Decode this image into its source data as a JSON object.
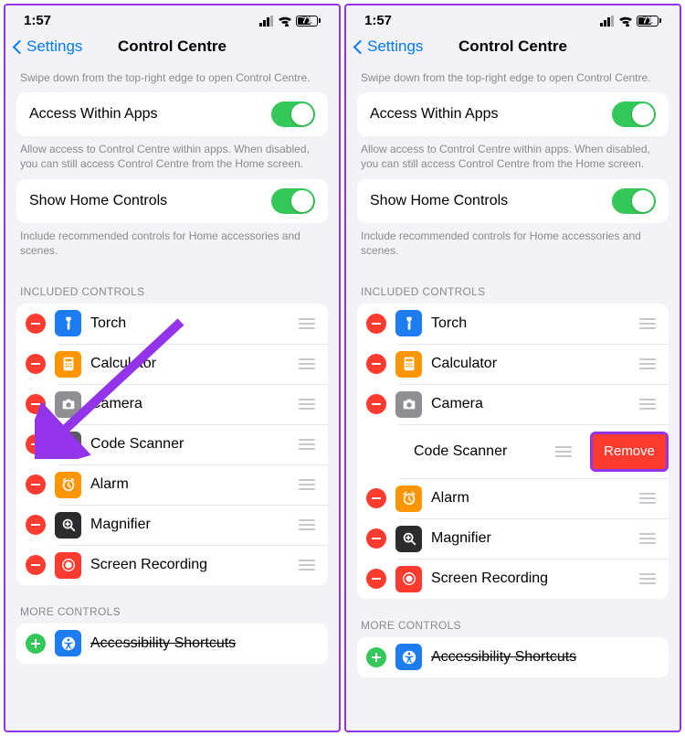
{
  "status": {
    "time": "1:57",
    "battery": "71"
  },
  "nav": {
    "back": "Settings",
    "title": "Control Centre"
  },
  "intro": "Swipe down from the top-right edge to open Control Centre.",
  "access": {
    "label": "Access Within Apps",
    "desc": "Allow access to Control Centre within apps. When disabled, you can still access Control Centre from the Home screen."
  },
  "home": {
    "label": "Show Home Controls",
    "desc": "Include recommended controls for Home accessories and scenes."
  },
  "sections": {
    "included": "INCLUDED CONTROLS",
    "more": "MORE CONTROLS"
  },
  "included_items": [
    {
      "label": "Torch",
      "icon": "torch",
      "color": "ic-blue"
    },
    {
      "label": "Calculator",
      "icon": "calculator",
      "color": "ic-orange"
    },
    {
      "label": "Camera",
      "icon": "camera",
      "color": "ic-gray"
    },
    {
      "label": "Code Scanner",
      "icon": "qr",
      "color": "ic-darkgray"
    },
    {
      "label": "Alarm",
      "icon": "alarm",
      "color": "ic-orange"
    },
    {
      "label": "Magnifier",
      "icon": "magnifier",
      "color": "ic-black"
    },
    {
      "label": "Screen Recording",
      "icon": "record",
      "color": "ic-red"
    }
  ],
  "more_items": [
    {
      "label": "Accessibility Shortcuts",
      "icon": "accessibility",
      "color": "ic-blue"
    }
  ],
  "remove_label": "Remove"
}
